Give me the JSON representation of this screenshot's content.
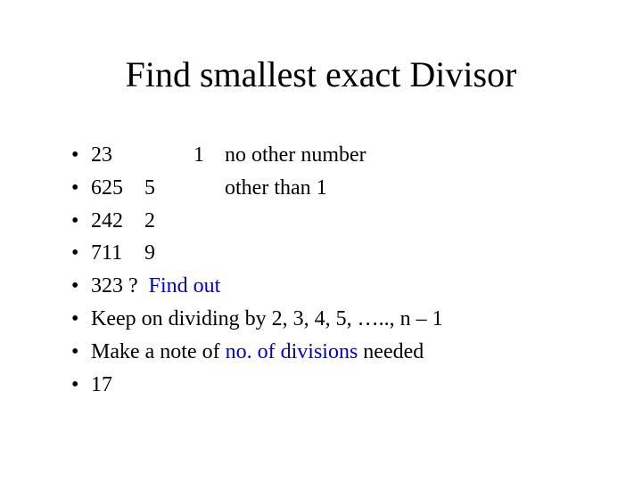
{
  "title": "Find smallest exact Divisor",
  "bullets": {
    "b1": {
      "a": "23",
      "b": "1",
      "c": "no other number"
    },
    "b2": {
      "a": "625",
      "b": "5",
      "c": "other than 1"
    },
    "b3": {
      "a": "242",
      "b": "2"
    },
    "b4": {
      "a": "711",
      "b": "9"
    },
    "b5": {
      "prefix": "323 ?  ",
      "link": "Find out"
    },
    "b6": {
      "text": " Keep on dividing by 2, 3, 4, 5, ….., n – 1"
    },
    "b7": {
      "prefix": "Make a note of ",
      "highlight": "no. of divisions",
      "suffix": " needed"
    },
    "b8": {
      "text": "17"
    }
  },
  "bullet_char": "•"
}
